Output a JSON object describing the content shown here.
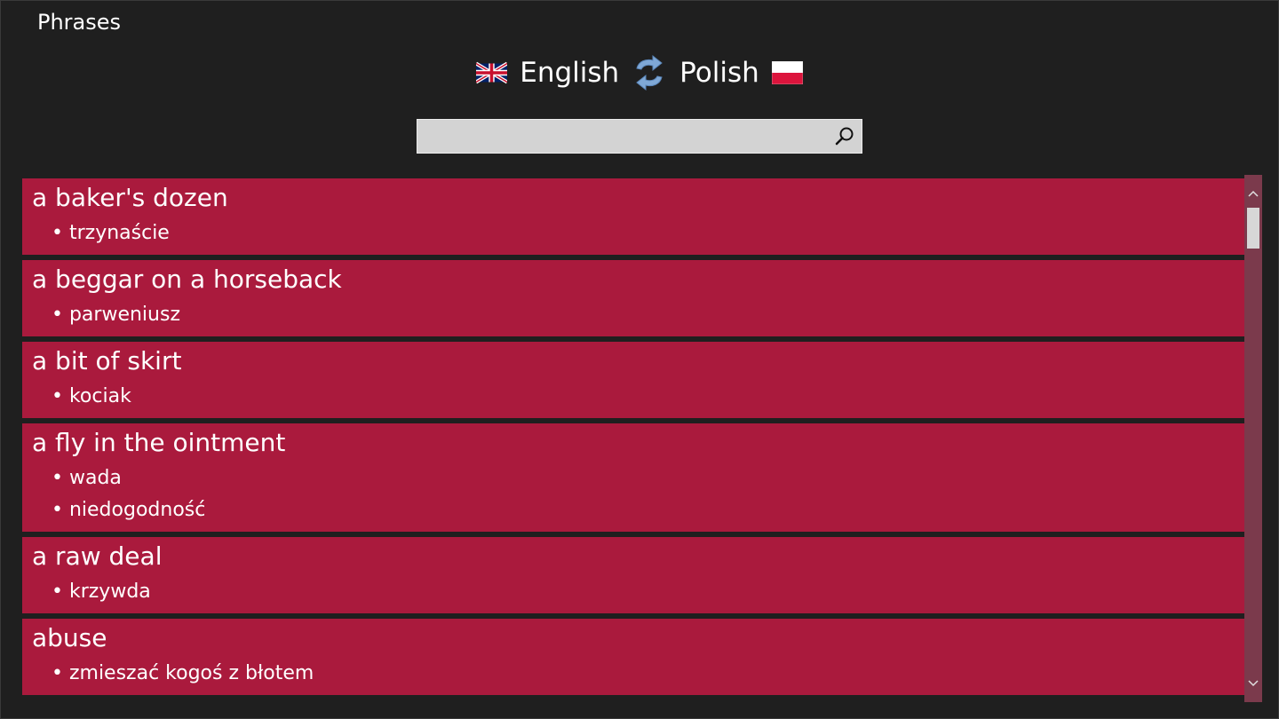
{
  "app": {
    "title": "Phrases"
  },
  "languages": {
    "source": "English",
    "target": "Polish",
    "source_flag": "uk-flag-icon",
    "target_flag": "poland-flag-icon",
    "swap_icon": "swap-languages-icon"
  },
  "search": {
    "value": "",
    "placeholder": "",
    "icon": "search-icon"
  },
  "colors": {
    "background": "#1f1f1f",
    "item_background": "#aa1a3d",
    "search_background": "#d3d3d3",
    "text": "#ffffff"
  },
  "phrases": [
    {
      "phrase": "a baker's dozen",
      "translations": [
        "• trzynaście"
      ]
    },
    {
      "phrase": "a beggar on a horseback",
      "translations": [
        "• parweniusz"
      ]
    },
    {
      "phrase": "a bit of skirt",
      "translations": [
        "• kociak"
      ]
    },
    {
      "phrase": "a fly in the ointment",
      "translations": [
        "• wada",
        "• niedogodność"
      ]
    },
    {
      "phrase": "a raw deal",
      "translations": [
        "• krzywda"
      ]
    },
    {
      "phrase": "abuse",
      "translations": [
        "• zmieszać kogoś z błotem"
      ]
    }
  ]
}
